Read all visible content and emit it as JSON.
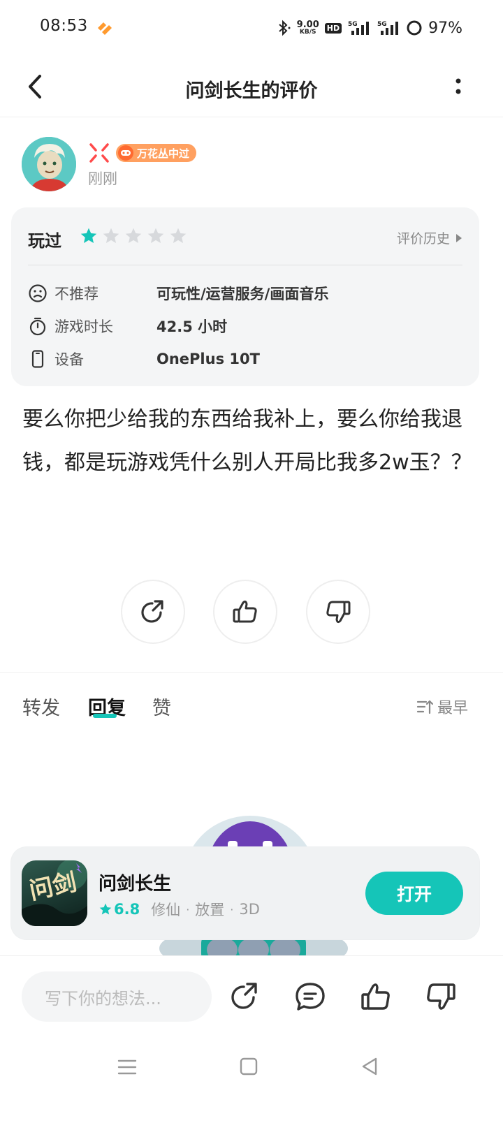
{
  "status_bar": {
    "time": "08:53",
    "net_speed": "9.00",
    "net_speed_unit": "KB/S",
    "hd_badge": "HD",
    "signal_1": "5G",
    "signal_2": "5G",
    "battery": "97%"
  },
  "header": {
    "title": "问剑长生的评价"
  },
  "author": {
    "badge_title": "万花丛中过",
    "post_time": "刚刚"
  },
  "review_card": {
    "played_label": "玩过",
    "rating": 1,
    "rating_max": 5,
    "history_link": "评价历史",
    "rows": [
      {
        "icon": "sad-face-icon",
        "label": "不推荐",
        "value": "可玩性/运营服务/画面音乐"
      },
      {
        "icon": "stopwatch-icon",
        "label": "游戏时长",
        "value": "42.5 小时"
      },
      {
        "icon": "phone-icon",
        "label": "设备",
        "value": "OnePlus 10T"
      }
    ]
  },
  "review_text": "要么你把少给我的东西给我补上，要么你给我退钱，都是玩游戏凭什么别人开局比我多2w玉？？",
  "tabs": {
    "repost": "转发",
    "reply": "回复",
    "like": "赞",
    "active": "reply",
    "sort_label": "最早"
  },
  "app_banner": {
    "name": "问剑长生",
    "score": "6.8",
    "tags": [
      "修仙",
      "放置",
      "3D"
    ],
    "tag_separator": "·",
    "open_label": "打开",
    "icon_text": "问剑"
  },
  "bottom_bar": {
    "input_placeholder": "写下你的想法..."
  },
  "colors": {
    "accent": "#15c5b8",
    "badge_orange": "#ffa060",
    "card_bg": "#f4f5f6",
    "star_inactive": "#d7d9dc"
  }
}
